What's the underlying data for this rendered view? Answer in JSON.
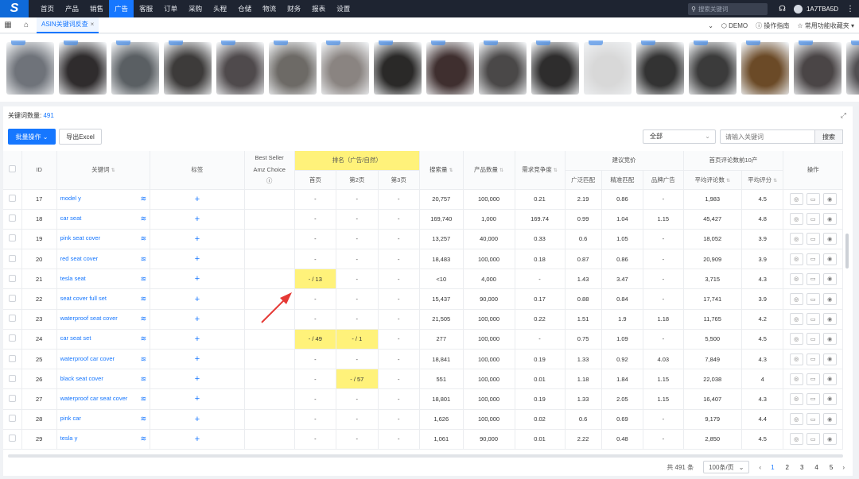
{
  "nav": {
    "logo": "S",
    "menu": [
      "首页",
      "产品",
      "销售",
      "广告",
      "客服",
      "订单",
      "采购",
      "头程",
      "仓储",
      "物流",
      "财务",
      "报表",
      "设置"
    ],
    "active_index": 3,
    "search_placeholder": "搜索关键词",
    "user": "1A7TBA5D"
  },
  "tabbar": {
    "tab_label": "ASIN关键词反查",
    "demo": "DEMO",
    "guide": "操作指南",
    "favorites": "常用功能收藏夹"
  },
  "thumbnails": [
    "#6f737a",
    "#2f2c2d",
    "#5a5f63",
    "#3d3b3a",
    "#4f4a4c",
    "#6d6a66",
    "#8a8481",
    "#2a2928",
    "#3f2f2f",
    "#4a4848",
    "#2e2d2d",
    "#d8d8d8",
    "#333333",
    "#3b3b3b",
    "#6b4a27",
    "#4a4546",
    "#514f52"
  ],
  "panel": {
    "kw_count_label": "关键词数量:",
    "kw_count": "491",
    "batch_btn": "批量操作",
    "export_btn": "导出Excel",
    "filter_value": "全部",
    "kw_placeholder": "请输入关键词",
    "search_btn": "搜索"
  },
  "table": {
    "h": {
      "id": "ID",
      "keyword": "关键词",
      "tag": "标签",
      "best_seller": "Best Seller",
      "amz_choice": "Amz Choice",
      "rank": "排名（广告/自然）",
      "page1": "首页",
      "page2": "第2页",
      "page3": "第3页",
      "search_vol": "搜索量",
      "product_count": "产品数量",
      "demand": "需求竞争度",
      "bid": "建议竞价",
      "broad": "广泛匹配",
      "exact": "精准匹配",
      "brand_ad": "品牌广告",
      "top10": "首页评论数前10产",
      "avg_reviews": "平均评论数",
      "avg_rating": "平均评分",
      "ops": "操作"
    },
    "rows": [
      {
        "id": "17",
        "kw": "model y",
        "p1": "-",
        "p2": "-",
        "p3": "-",
        "sv": "20,757",
        "pc": "100,000",
        "dc": "0.21",
        "broad": "2.19",
        "exact": "0.86",
        "brand": "-",
        "rev": "1,983",
        "rate": "4.5"
      },
      {
        "id": "18",
        "kw": "car seat",
        "p1": "-",
        "p2": "-",
        "p3": "-",
        "sv": "169,740",
        "pc": "1,000",
        "dc": "169.74",
        "broad": "0.99",
        "exact": "1.04",
        "brand": "1.15",
        "rev": "45,427",
        "rate": "4.8"
      },
      {
        "id": "19",
        "kw": "pink seat cover",
        "p1": "-",
        "p2": "-",
        "p3": "-",
        "sv": "13,257",
        "pc": "40,000",
        "dc": "0.33",
        "broad": "0.6",
        "exact": "1.05",
        "brand": "-",
        "rev": "18,052",
        "rate": "3.9"
      },
      {
        "id": "20",
        "kw": "red seat cover",
        "p1": "-",
        "p2": "-",
        "p3": "-",
        "sv": "18,483",
        "pc": "100,000",
        "dc": "0.18",
        "broad": "0.87",
        "exact": "0.86",
        "brand": "-",
        "rev": "20,909",
        "rate": "3.9"
      },
      {
        "id": "21",
        "kw": "tesla seat",
        "p1": "- / 13",
        "p2": "-",
        "p3": "-",
        "sv": "<10",
        "pc": "4,000",
        "dc": "-",
        "broad": "1.43",
        "exact": "3.47",
        "brand": "-",
        "rev": "3,715",
        "rate": "4.3",
        "hl": "p1"
      },
      {
        "id": "22",
        "kw": "seat cover full set",
        "p1": "-",
        "p2": "-",
        "p3": "-",
        "sv": "15,437",
        "pc": "90,000",
        "dc": "0.17",
        "broad": "0.88",
        "exact": "0.84",
        "brand": "-",
        "rev": "17,741",
        "rate": "3.9"
      },
      {
        "id": "23",
        "kw": "waterproof seat cover",
        "p1": "-",
        "p2": "-",
        "p3": "-",
        "sv": "21,505",
        "pc": "100,000",
        "dc": "0.22",
        "broad": "1.51",
        "exact": "1.9",
        "brand": "1.18",
        "rev": "11,765",
        "rate": "4.2"
      },
      {
        "id": "24",
        "kw": "car seat set",
        "p1": "- / 49",
        "p2": "- / 1",
        "p3": "-",
        "sv": "277",
        "pc": "100,000",
        "dc": "-",
        "broad": "0.75",
        "exact": "1.09",
        "brand": "-",
        "rev": "5,500",
        "rate": "4.5",
        "hl": "p1p2"
      },
      {
        "id": "25",
        "kw": "waterproof car cover",
        "p1": "-",
        "p2": "-",
        "p3": "-",
        "sv": "18,841",
        "pc": "100,000",
        "dc": "0.19",
        "broad": "1.33",
        "exact": "0.92",
        "brand": "4.03",
        "rev": "7,849",
        "rate": "4.3"
      },
      {
        "id": "26",
        "kw": "black seat cover",
        "p1": "-",
        "p2": "- / 57",
        "p3": "-",
        "sv": "551",
        "pc": "100,000",
        "dc": "0.01",
        "broad": "1.18",
        "exact": "1.84",
        "brand": "1.15",
        "rev": "22,038",
        "rate": "4",
        "hl": "p2"
      },
      {
        "id": "27",
        "kw": "waterproof car seat cover",
        "p1": "-",
        "p2": "-",
        "p3": "-",
        "sv": "18,801",
        "pc": "100,000",
        "dc": "0.19",
        "broad": "1.33",
        "exact": "2.05",
        "brand": "1.15",
        "rev": "16,407",
        "rate": "4.3"
      },
      {
        "id": "28",
        "kw": "pink car",
        "p1": "-",
        "p2": "-",
        "p3": "-",
        "sv": "1,626",
        "pc": "100,000",
        "dc": "0.02",
        "broad": "0.6",
        "exact": "0.69",
        "brand": "-",
        "rev": "9,179",
        "rate": "4.4"
      },
      {
        "id": "29",
        "kw": "tesla y",
        "p1": "-",
        "p2": "-",
        "p3": "-",
        "sv": "1,061",
        "pc": "90,000",
        "dc": "0.01",
        "broad": "2.22",
        "exact": "0.48",
        "brand": "-",
        "rev": "2,850",
        "rate": "4.5"
      }
    ]
  },
  "footer": {
    "total": "共 491 条",
    "page_size": "100条/页",
    "pages": [
      "1",
      "2",
      "3",
      "4",
      "5"
    ],
    "current_page": "1"
  },
  "colors": {
    "accent": "#1677ff",
    "highlight": "#fff27a",
    "nav_bg": "#1e2431",
    "arrow": "#e53935"
  }
}
